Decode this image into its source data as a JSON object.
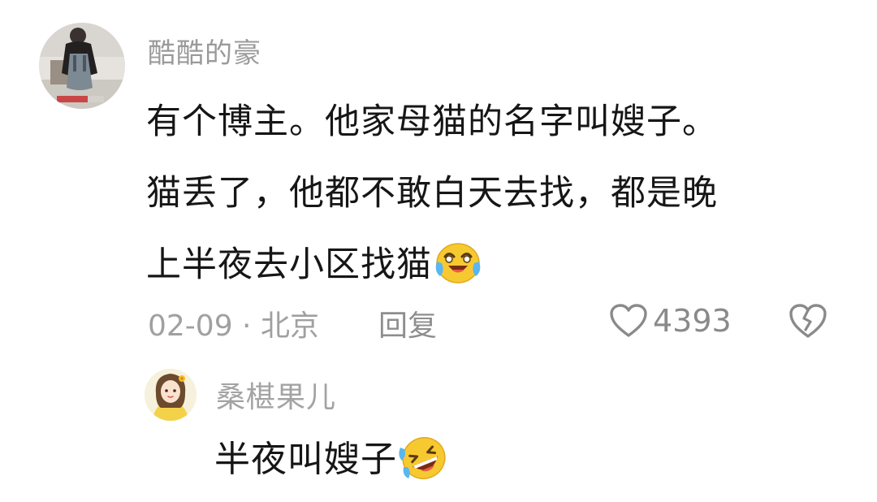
{
  "comment": {
    "username": "酷酷的豪",
    "text_lines": [
      "有个博主。他家母猫的名字叫嫂子。",
      "猫丢了，他都不敢白天去找，都是晚",
      "上半夜去小区找猫"
    ],
    "emoji_main": "crying-laughing-emoji",
    "date_location": "02-09 · 北京",
    "reply_label": "回复",
    "like_count": "4393"
  },
  "reply": {
    "username": "桑椹果儿",
    "text": "半夜叫嫂子",
    "emoji": "rolling-on-floor-laughing-emoji"
  },
  "colors": {
    "username": "#9a9a9a",
    "text": "#161616",
    "meta": "#a0a0a0",
    "emoji_face": "#f7c930",
    "tears": "#59b6f0"
  }
}
